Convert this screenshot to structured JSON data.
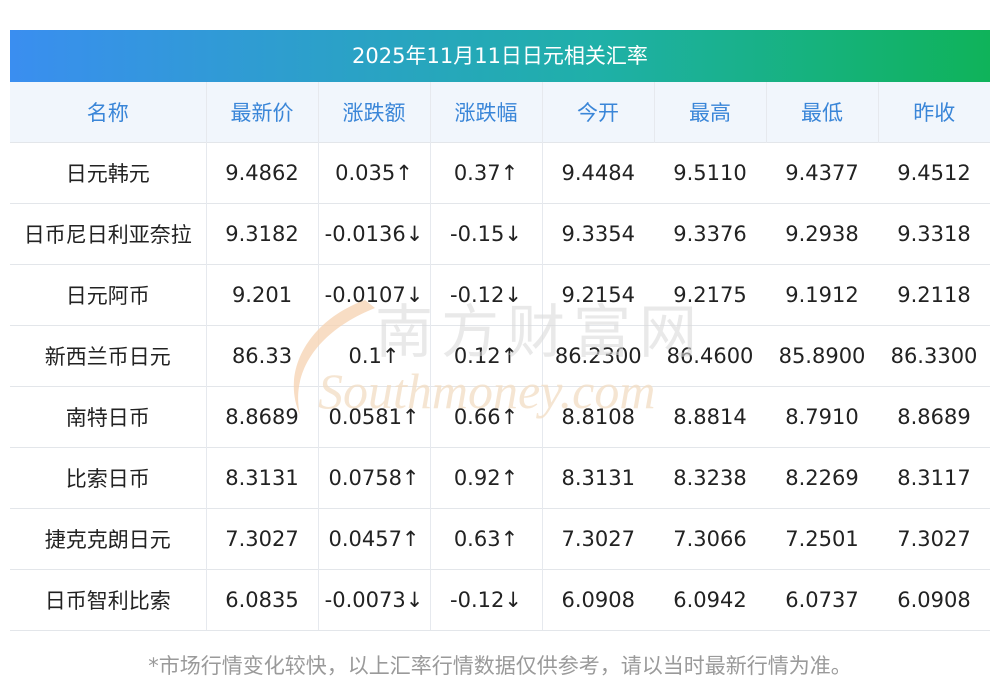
{
  "title": "2025年11月11日日元相关汇率",
  "headers": [
    "名称",
    "最新价",
    "涨跌额",
    "涨跌幅",
    "今开",
    "最高",
    "最低",
    "昨收"
  ],
  "rows": [
    {
      "name": "日元韩元",
      "latest": "9.4862",
      "change": "0.035↑",
      "pct": "0.37↑",
      "open": "9.4484",
      "high": "9.5110",
      "low": "9.4377",
      "prev": "9.4512",
      "trend": "up"
    },
    {
      "name": "日币尼日利亚奈拉",
      "latest": "9.3182",
      "change": "-0.0136↓",
      "pct": "-0.15↓",
      "open": "9.3354",
      "high": "9.3376",
      "low": "9.2938",
      "prev": "9.3318",
      "trend": "down"
    },
    {
      "name": "日元阿币",
      "latest": "9.201",
      "change": "-0.0107↓",
      "pct": "-0.12↓",
      "open": "9.2154",
      "high": "9.2175",
      "low": "9.1912",
      "prev": "9.2118",
      "trend": "down"
    },
    {
      "name": "新西兰币日元",
      "latest": "86.33",
      "change": "0.1↑",
      "pct": "0.12↑",
      "open": "86.2300",
      "high": "86.4600",
      "low": "85.8900",
      "prev": "86.3300",
      "trend": "up"
    },
    {
      "name": "南特日币",
      "latest": "8.8689",
      "change": "0.0581↑",
      "pct": "0.66↑",
      "open": "8.8108",
      "high": "8.8814",
      "low": "8.7910",
      "prev": "8.8689",
      "trend": "up"
    },
    {
      "name": "比索日币",
      "latest": "8.3131",
      "change": "0.0758↑",
      "pct": "0.92↑",
      "open": "8.3131",
      "high": "8.3238",
      "low": "8.2269",
      "prev": "8.3117",
      "trend": "up"
    },
    {
      "name": "捷克克朗日元",
      "latest": "7.3027",
      "change": "0.0457↑",
      "pct": "0.63↑",
      "open": "7.3027",
      "high": "7.3066",
      "low": "7.2501",
      "prev": "7.3027",
      "trend": "up"
    },
    {
      "name": "日币智利比索",
      "latest": "6.0835",
      "change": "-0.0073↓",
      "pct": "-0.12↓",
      "open": "6.0908",
      "high": "6.0942",
      "low": "6.0737",
      "prev": "6.0908",
      "trend": "down"
    }
  ],
  "watermark": {
    "cn": "南方财富网",
    "en": "Southmoney.com"
  },
  "footnote": "*市场行情变化较快，以上汇率行情数据仅供参考，请以当时最新行情为准。",
  "colors": {
    "up": "#e8161b",
    "down": "#178a1f",
    "header_text": "#3a86d8",
    "header_bg": "#f1f6fc"
  }
}
